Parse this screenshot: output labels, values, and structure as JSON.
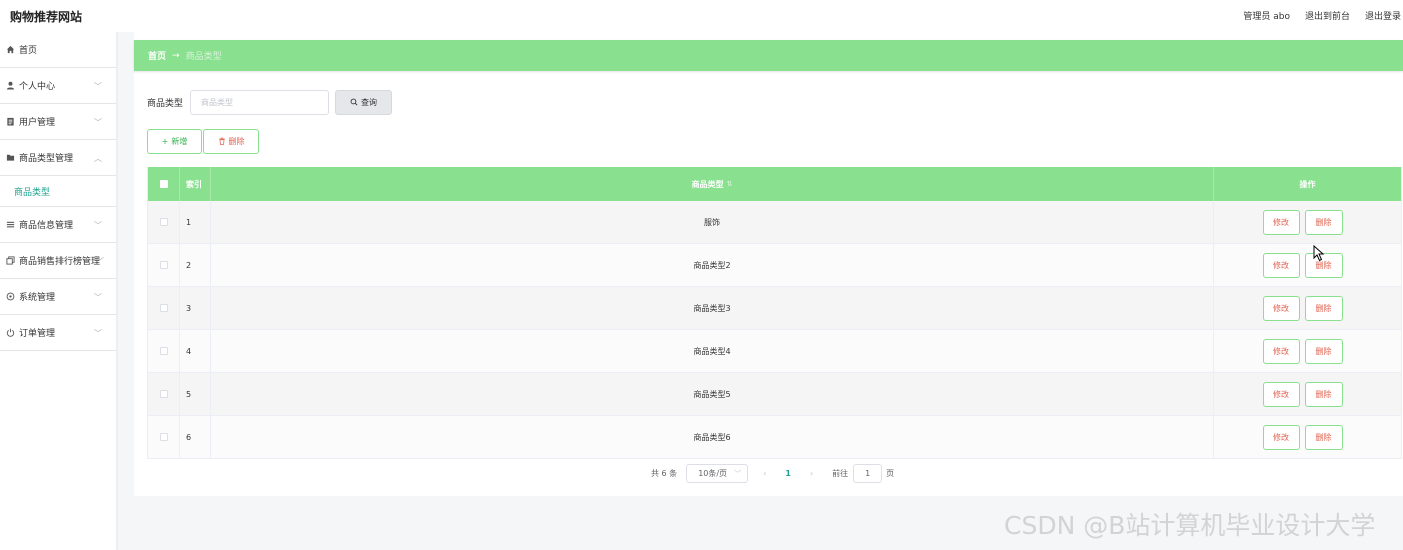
{
  "header": {
    "brand": "购物推荐网站",
    "admin_label": "管理员 abo",
    "back_front_label": "退出到前台",
    "logout_label": "退出登录"
  },
  "sidebar": {
    "items": [
      {
        "label": "首页",
        "icon": "home-icon"
      },
      {
        "label": "个人中心",
        "icon": "user-icon"
      },
      {
        "label": "用户管理",
        "icon": "clipboard-icon"
      },
      {
        "label": "商品类型管理",
        "icon": "folder-icon"
      },
      {
        "label": "商品信息管理",
        "icon": "list-icon"
      },
      {
        "label": "商品销售排行榜管理",
        "icon": "copy-icon"
      },
      {
        "label": "系统管理",
        "icon": "settings-icon"
      },
      {
        "label": "订单管理",
        "icon": "power-icon"
      }
    ],
    "submenu_active": "商品类型"
  },
  "breadcrumb": {
    "home": "首页",
    "separator": "→",
    "current": "商品类型"
  },
  "search": {
    "label": "商品类型",
    "placeholder": "商品类型",
    "query_button": "查询"
  },
  "actions": {
    "add_label": "新增",
    "delete_label": "删除"
  },
  "table": {
    "headers": {
      "index": "索引",
      "type": "商品类型",
      "operation": "操作"
    },
    "rows": [
      {
        "index": "1",
        "type": "服饰"
      },
      {
        "index": "2",
        "type": "商品类型2"
      },
      {
        "index": "3",
        "type": "商品类型3"
      },
      {
        "index": "4",
        "type": "商品类型4"
      },
      {
        "index": "5",
        "type": "商品类型5"
      },
      {
        "index": "6",
        "type": "商品类型6"
      }
    ],
    "edit_label": "修改",
    "delete_label": "删除"
  },
  "pagination": {
    "total": "共 6 条",
    "page_size": "10条/页",
    "current_page": "1",
    "goto_label": "前往",
    "goto_value": "1",
    "page_unit": "页"
  },
  "watermark": "CSDN @B站计算机毕业设计大学",
  "colors": {
    "accent_green": "#89e08f",
    "active_teal": "#1fa28f",
    "danger_red": "#e0624f"
  }
}
